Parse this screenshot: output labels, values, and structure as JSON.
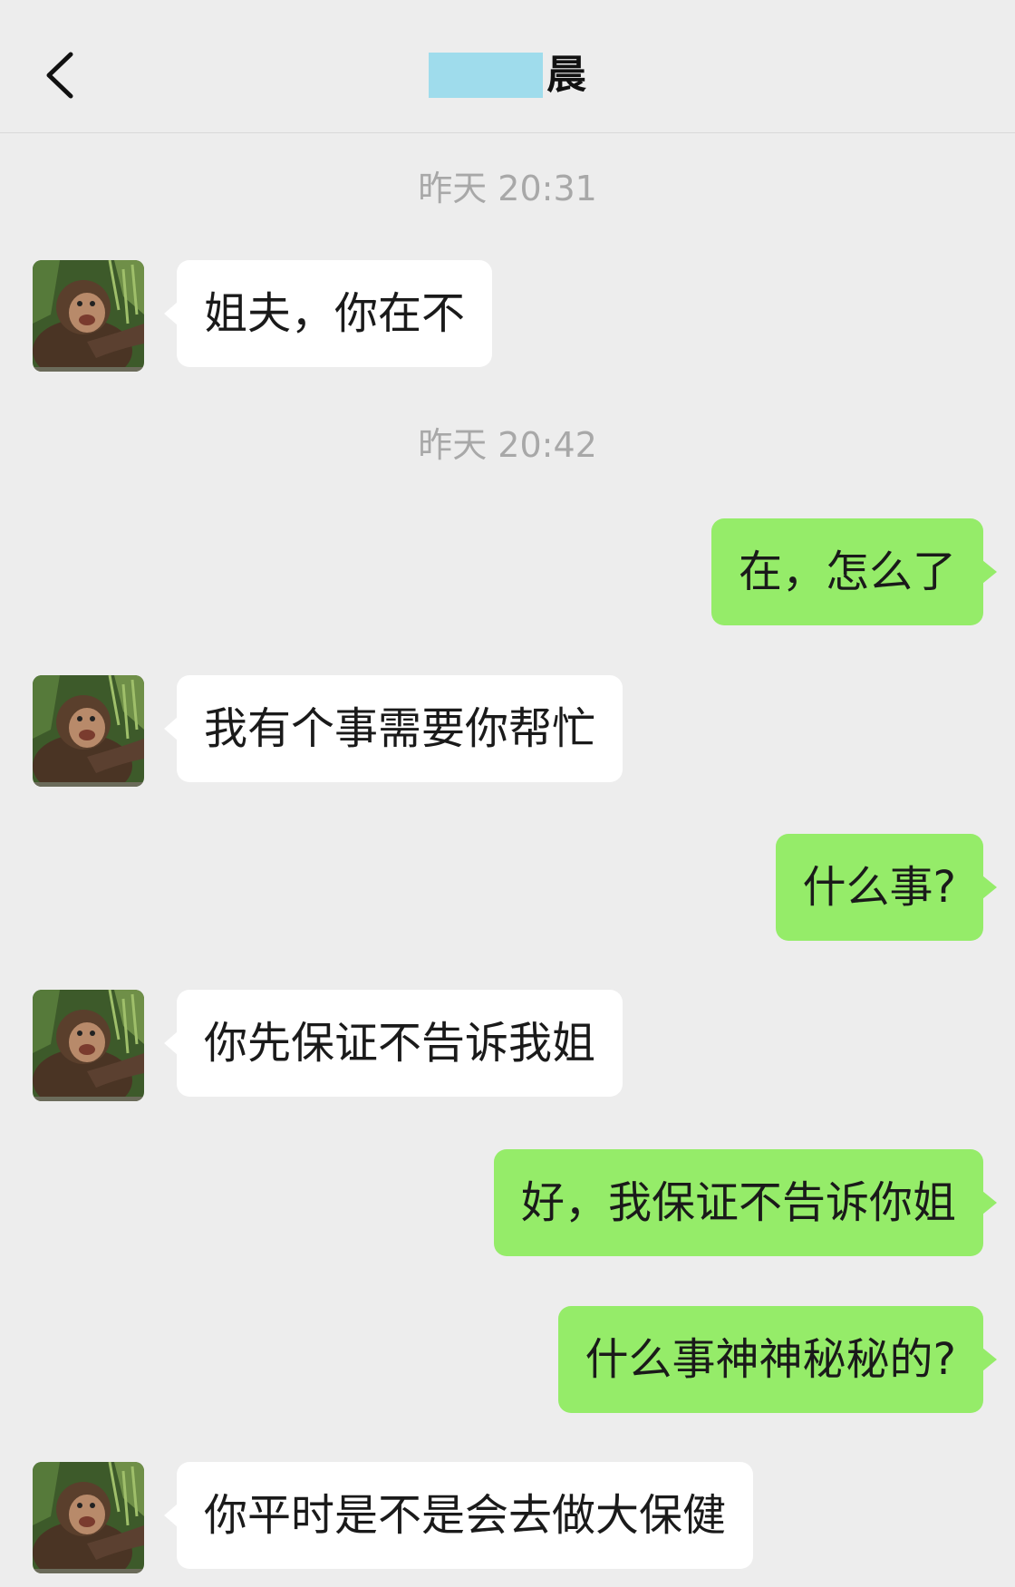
{
  "header": {
    "title_visible": "晨",
    "back_icon": "chevron-left-icon",
    "redaction_color": "#9fdcec"
  },
  "colors": {
    "background": "#ededed",
    "incoming_bubble": "#ffffff",
    "outgoing_bubble": "#95ec69"
  },
  "messages": [
    {
      "type": "time",
      "text": "昨天 20:31"
    },
    {
      "type": "incoming",
      "text": "姐夫，你在不"
    },
    {
      "type": "time",
      "text": "昨天 20:42"
    },
    {
      "type": "outgoing",
      "text": "在，怎么了"
    },
    {
      "type": "incoming",
      "text": "我有个事需要你帮忙"
    },
    {
      "type": "outgoing",
      "text": "什么事?"
    },
    {
      "type": "incoming",
      "text": "你先保证不告诉我姐"
    },
    {
      "type": "outgoing",
      "text": "好，我保证不告诉你姐"
    },
    {
      "type": "outgoing",
      "text": "什么事神神秘秘的?"
    },
    {
      "type": "incoming",
      "text": "你平时是不是会去做大保健"
    }
  ]
}
